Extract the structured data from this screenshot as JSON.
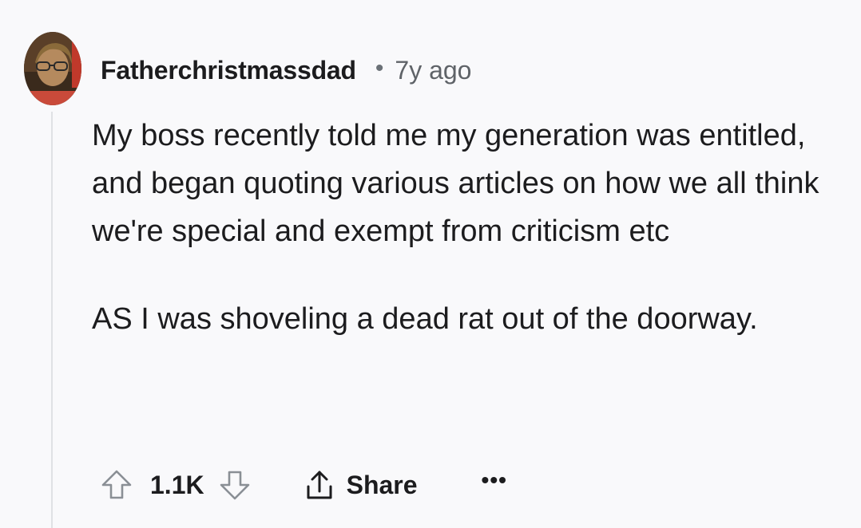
{
  "comment": {
    "username": "Fatherchristmassdad",
    "separator": "•",
    "timestamp": "7y ago",
    "paragraphs": [
      "My boss recently told me my generation was entitled, and began quoting various articles on how we all think we're special and exempt from criticism etc",
      "AS I was shoveling a dead rat out of the doorway."
    ]
  },
  "actions": {
    "upvote_icon": "arrow-up-icon",
    "score": "1.1K",
    "downvote_icon": "arrow-down-icon",
    "share_icon": "share-icon",
    "share_label": "Share",
    "more_label": "•••"
  },
  "colors": {
    "background": "#f9f9fb",
    "text": "#1c1c1e",
    "muted": "#5f6368",
    "thread_line": "#dfe1e4"
  }
}
